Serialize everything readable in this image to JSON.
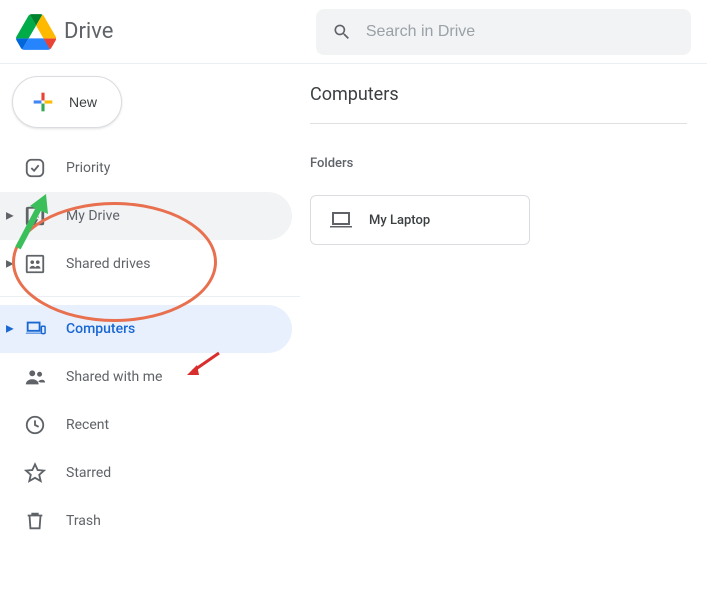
{
  "header": {
    "app_title": "Drive",
    "search_placeholder": "Search in Drive"
  },
  "sidebar": {
    "new_label": "New",
    "items": [
      {
        "label": "Priority"
      },
      {
        "label": "My Drive"
      },
      {
        "label": "Shared drives"
      },
      {
        "label": "Computers"
      },
      {
        "label": "Shared with me"
      },
      {
        "label": "Recent"
      },
      {
        "label": "Starred"
      },
      {
        "label": "Trash"
      }
    ]
  },
  "main": {
    "section_title": "Computers",
    "folders_label": "Folders",
    "folders": [
      {
        "name": "My Laptop"
      }
    ]
  }
}
